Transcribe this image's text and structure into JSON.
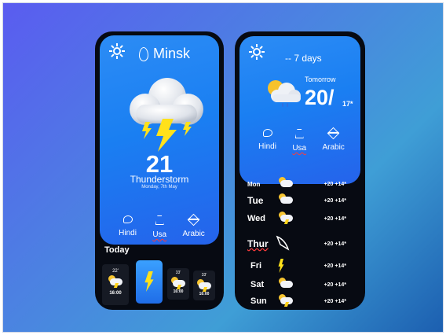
{
  "left": {
    "city": "Minsk",
    "temperature": "21",
    "condition": "Thunderstorm",
    "date": "Monday, 7th May",
    "languages": [
      "Hindi",
      "Usa",
      "Arabic"
    ],
    "today_label": "Today",
    "hourly": [
      {
        "temp": "22'",
        "time": "16:00"
      },
      {
        "temp": "",
        "time": ""
      },
      {
        "temp": "33'",
        "time": "16:00"
      },
      {
        "temp": "33'",
        "time": "16:00"
      }
    ]
  },
  "right": {
    "title": "-- 7 days",
    "tomorrow_label": "Tomorrow",
    "temp_high": "20/",
    "temp_low": "17*",
    "languages": [
      "Hindi",
      "Usa",
      "Arabic"
    ],
    "days": [
      {
        "day": "Mon",
        "temps": "+20 +14*",
        "icon": "sun-cloud-icon"
      },
      {
        "day": "Tue",
        "temps": "+20 +14*",
        "icon": "sun-cloud-icon"
      },
      {
        "day": "Wed",
        "temps": "+20 +14*",
        "icon": "storm-cloud-icon"
      },
      {
        "day": "Thur",
        "temps": "+20 +14*",
        "icon": "wind-icon"
      },
      {
        "day": "Fri",
        "temps": "+20 +14*",
        "icon": "lightning-icon"
      },
      {
        "day": "Sat",
        "temps": "+20 +14*",
        "icon": "sun-cloud-icon"
      },
      {
        "day": "Sun",
        "temps": "+20 +14*",
        "icon": "storm-cloud-icon"
      }
    ]
  },
  "colors": {
    "card_blue": "#1a7ff2",
    "phone_bg": "#070a12",
    "bolt": "#ffe11a"
  }
}
